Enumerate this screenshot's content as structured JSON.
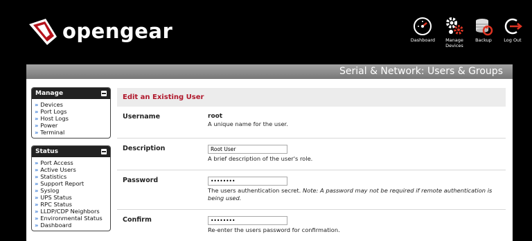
{
  "brand": {
    "name": "opengear"
  },
  "toolbar": [
    {
      "label": "Dashboard",
      "icon": "dashboard-icon"
    },
    {
      "label": "Manage\nDevices",
      "icon": "gears-icon"
    },
    {
      "label": "Backup",
      "icon": "backup-icon"
    },
    {
      "label": "Log Out",
      "icon": "logout-icon"
    }
  ],
  "page_title": "Serial & Network: Users & Groups",
  "sidebar": {
    "manage": {
      "title": "Manage",
      "items": [
        "Devices",
        "Port Logs",
        "Host Logs",
        "Power",
        "Terminal"
      ]
    },
    "status": {
      "title": "Status",
      "items": [
        "Port Access",
        "Active Users",
        "Statistics",
        "Support Report",
        "Syslog",
        "UPS Status",
        "RPC Status",
        "LLDP/CDP Neighbors",
        "Environmental Status",
        "Dashboard"
      ]
    }
  },
  "form": {
    "heading": "Edit an Existing User",
    "username": {
      "label": "Username",
      "value": "root",
      "help": "A unique name for the user."
    },
    "description": {
      "label": "Description",
      "value": "Root User",
      "help": "A brief description of the user's role."
    },
    "password": {
      "label": "Password",
      "value": "••••••••",
      "help": "The users authentication secret. ",
      "note": "Note: A password may not be required if remote authentication is being used."
    },
    "confirm": {
      "label": "Confirm",
      "value": "••••••••",
      "help": "Re-enter the users password for confirmation."
    }
  },
  "colors": {
    "accent": "#b0172b",
    "link_bullet": "#3a7bd5"
  }
}
